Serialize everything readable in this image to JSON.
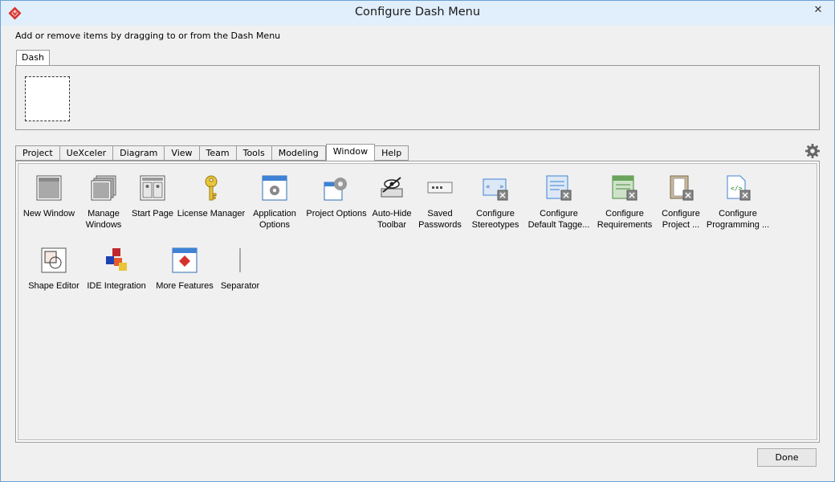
{
  "window": {
    "title": "Configure Dash Menu",
    "close_glyph": "✕"
  },
  "hint": "Add or remove items by dragging to or from the Dash Menu",
  "dash": {
    "tab_label": "Dash"
  },
  "tabs": [
    {
      "label": "Project",
      "active": false
    },
    {
      "label": "UeXceler",
      "active": false
    },
    {
      "label": "Diagram",
      "active": false
    },
    {
      "label": "View",
      "active": false
    },
    {
      "label": "Team",
      "active": false
    },
    {
      "label": "Tools",
      "active": false
    },
    {
      "label": "Modeling",
      "active": false
    },
    {
      "label": "Window",
      "active": true
    },
    {
      "label": "Help",
      "active": false
    }
  ],
  "items": [
    {
      "label": "New Window",
      "icon": "new-window-icon"
    },
    {
      "label": "Manage\nWindows",
      "icon": "manage-windows-icon"
    },
    {
      "label": "Start Page",
      "icon": "start-page-icon"
    },
    {
      "label": "License Manager",
      "icon": "license-key-icon"
    },
    {
      "label": "Application\nOptions",
      "icon": "application-options-icon"
    },
    {
      "label": "Project Options",
      "icon": "project-options-icon"
    },
    {
      "label": "Auto-Hide\nToolbar",
      "icon": "auto-hide-toolbar-icon"
    },
    {
      "label": "Saved\nPasswords",
      "icon": "saved-passwords-icon"
    },
    {
      "label": "Configure\nStereotypes",
      "icon": "configure-stereotypes-icon"
    },
    {
      "label": "Configure\nDefault Tagge...",
      "icon": "configure-tagged-values-icon"
    },
    {
      "label": "Configure\nRequirements",
      "icon": "configure-requirements-icon"
    },
    {
      "label": "Configure\nProject ...",
      "icon": "configure-project-icon"
    },
    {
      "label": "Configure\nProgramming ...",
      "icon": "configure-programming-icon"
    },
    {
      "label": "Shape Editor",
      "icon": "shape-editor-icon"
    },
    {
      "label": "IDE Integration",
      "icon": "ide-integration-icon"
    },
    {
      "label": "More Features",
      "icon": "more-features-icon"
    },
    {
      "label": "Separator",
      "icon": "separator-icon"
    }
  ],
  "done_label": "Done"
}
